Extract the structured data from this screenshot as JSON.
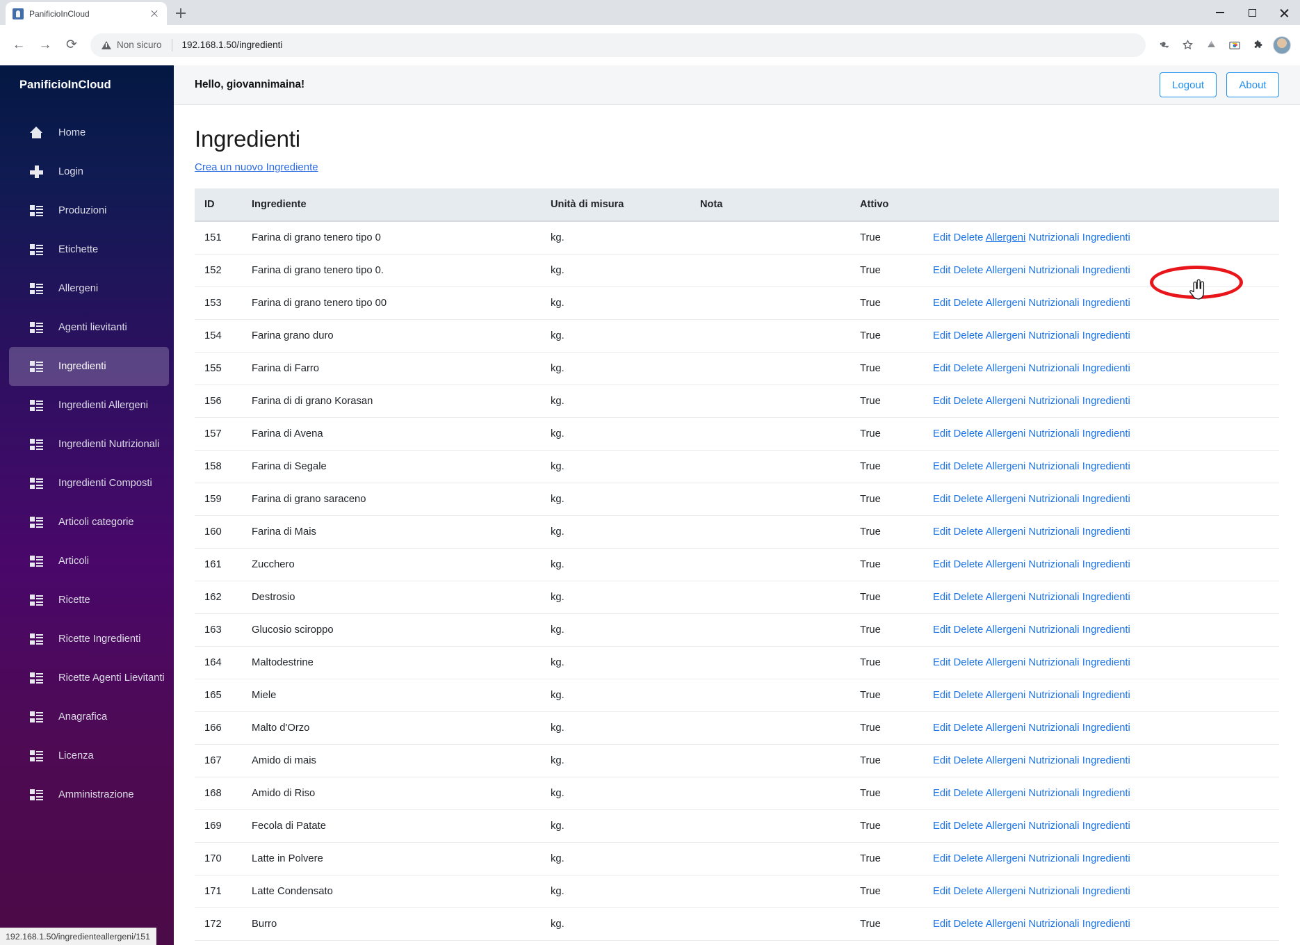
{
  "browser": {
    "tab": {
      "title": "PanificioInCloud",
      "favicon_icon": "app-favicon",
      "close_icon": "close-icon"
    },
    "newtab_icon": "plus-icon",
    "window_controls": {
      "minimize_icon": "minimize-icon",
      "maximize_icon": "maximize-icon",
      "close_icon": "window-close-icon"
    },
    "nav": {
      "back_icon": "arrow-left-icon",
      "forward_icon": "arrow-right-icon",
      "reload_icon": "reload-icon"
    },
    "omnibox": {
      "security_icon": "warning-triangle-icon",
      "security_label": "Non sicuro",
      "url": "192.168.1.50/ingredienti"
    },
    "toolbar_icons": [
      "key-icon",
      "star-icon",
      "drive-icon",
      "webstore-icon",
      "extensions-puzzle-icon",
      "profile-avatar"
    ],
    "status_bar": {
      "url": "192.168.1.50/ingredienteallergeni/151"
    }
  },
  "sidebar": {
    "brand": "PanificioInCloud",
    "items": [
      {
        "label": "Home",
        "icon": "home-icon",
        "active": false
      },
      {
        "label": "Login",
        "icon": "plus-icon",
        "active": false
      },
      {
        "label": "Produzioni",
        "icon": "list-icon",
        "active": false
      },
      {
        "label": "Etichette",
        "icon": "list-icon",
        "active": false
      },
      {
        "label": "Allergeni",
        "icon": "list-icon",
        "active": false
      },
      {
        "label": "Agenti lievitanti",
        "icon": "list-icon",
        "active": false
      },
      {
        "label": "Ingredienti",
        "icon": "list-icon",
        "active": true
      },
      {
        "label": "Ingredienti Allergeni",
        "icon": "list-icon",
        "active": false
      },
      {
        "label": "Ingredienti Nutrizionali",
        "icon": "list-icon",
        "active": false
      },
      {
        "label": "Ingredienti Composti",
        "icon": "list-icon",
        "active": false
      },
      {
        "label": "Articoli categorie",
        "icon": "list-icon",
        "active": false
      },
      {
        "label": "Articoli",
        "icon": "list-icon",
        "active": false
      },
      {
        "label": "Ricette",
        "icon": "list-icon",
        "active": false
      },
      {
        "label": "Ricette Ingredienti",
        "icon": "list-icon",
        "active": false
      },
      {
        "label": "Ricette Agenti Lievitanti",
        "icon": "list-icon",
        "active": false
      },
      {
        "label": "Anagrafica",
        "icon": "list-icon",
        "active": false
      },
      {
        "label": "Licenza",
        "icon": "list-icon",
        "active": false
      },
      {
        "label": "Amministrazione",
        "icon": "list-icon",
        "active": false
      }
    ]
  },
  "appbar": {
    "greeting": "Hello, giovannimaina!",
    "logout_label": "Logout",
    "about_label": "About"
  },
  "main": {
    "title": "Ingredienti",
    "create_link": "Crea un nuovo Ingrediente",
    "columns": [
      "ID",
      "Ingrediente",
      "Unità di misura",
      "Nota",
      "Attivo",
      ""
    ],
    "row_actions": [
      "Edit",
      "Delete",
      "Allergeni",
      "Nutrizionali",
      "Ingredienti"
    ],
    "rows": [
      {
        "id": "151",
        "name": "Farina di grano tenero tipo 0",
        "unit": "kg.",
        "nota": "",
        "attivo": "True"
      },
      {
        "id": "152",
        "name": "Farina di grano tenero tipo 0.",
        "unit": "kg.",
        "nota": "",
        "attivo": "True"
      },
      {
        "id": "153",
        "name": "Farina di grano tenero tipo 00",
        "unit": "kg.",
        "nota": "",
        "attivo": "True"
      },
      {
        "id": "154",
        "name": "Farina grano duro",
        "unit": "kg.",
        "nota": "",
        "attivo": "True"
      },
      {
        "id": "155",
        "name": "Farina di Farro",
        "unit": "kg.",
        "nota": "",
        "attivo": "True"
      },
      {
        "id": "156",
        "name": "Farina di di grano Korasan",
        "unit": "kg.",
        "nota": "",
        "attivo": "True"
      },
      {
        "id": "157",
        "name": "Farina di Avena",
        "unit": "kg.",
        "nota": "",
        "attivo": "True"
      },
      {
        "id": "158",
        "name": "Farina di Segale",
        "unit": "kg.",
        "nota": "",
        "attivo": "True"
      },
      {
        "id": "159",
        "name": "Farina di grano saraceno",
        "unit": "kg.",
        "nota": "",
        "attivo": "True"
      },
      {
        "id": "160",
        "name": "Farina di Mais",
        "unit": "kg.",
        "nota": "",
        "attivo": "True"
      },
      {
        "id": "161",
        "name": "Zucchero",
        "unit": "kg.",
        "nota": "",
        "attivo": "True"
      },
      {
        "id": "162",
        "name": "Destrosio",
        "unit": "kg.",
        "nota": "",
        "attivo": "True"
      },
      {
        "id": "163",
        "name": "Glucosio sciroppo",
        "unit": "kg.",
        "nota": "",
        "attivo": "True"
      },
      {
        "id": "164",
        "name": "Maltodestrine",
        "unit": "kg.",
        "nota": "",
        "attivo": "True"
      },
      {
        "id": "165",
        "name": "Miele",
        "unit": "kg.",
        "nota": "",
        "attivo": "True"
      },
      {
        "id": "166",
        "name": "Malto d'Orzo",
        "unit": "kg.",
        "nota": "",
        "attivo": "True"
      },
      {
        "id": "167",
        "name": "Amido di mais",
        "unit": "kg.",
        "nota": "",
        "attivo": "True"
      },
      {
        "id": "168",
        "name": "Amido di Riso",
        "unit": "kg.",
        "nota": "",
        "attivo": "True"
      },
      {
        "id": "169",
        "name": "Fecola di Patate",
        "unit": "kg.",
        "nota": "",
        "attivo": "True"
      },
      {
        "id": "170",
        "name": "Latte in Polvere",
        "unit": "kg.",
        "nota": "",
        "attivo": "True"
      },
      {
        "id": "171",
        "name": "Latte Condensato",
        "unit": "kg.",
        "nota": "",
        "attivo": "True"
      },
      {
        "id": "172",
        "name": "Burro",
        "unit": "kg.",
        "nota": "",
        "attivo": "True"
      }
    ]
  },
  "annotation": {
    "highlight_icon": "red-ellipse-annotation",
    "cursor_icon": "pointing-hand-cursor",
    "target_link": "Allergeni"
  },
  "colors": {
    "accent_link": "#1a73e8",
    "annotation_red": "#e8161b",
    "sidebar_top": "#041742",
    "sidebar_bottom": "#4b0a47",
    "button_blue": "#1b8ef2"
  }
}
